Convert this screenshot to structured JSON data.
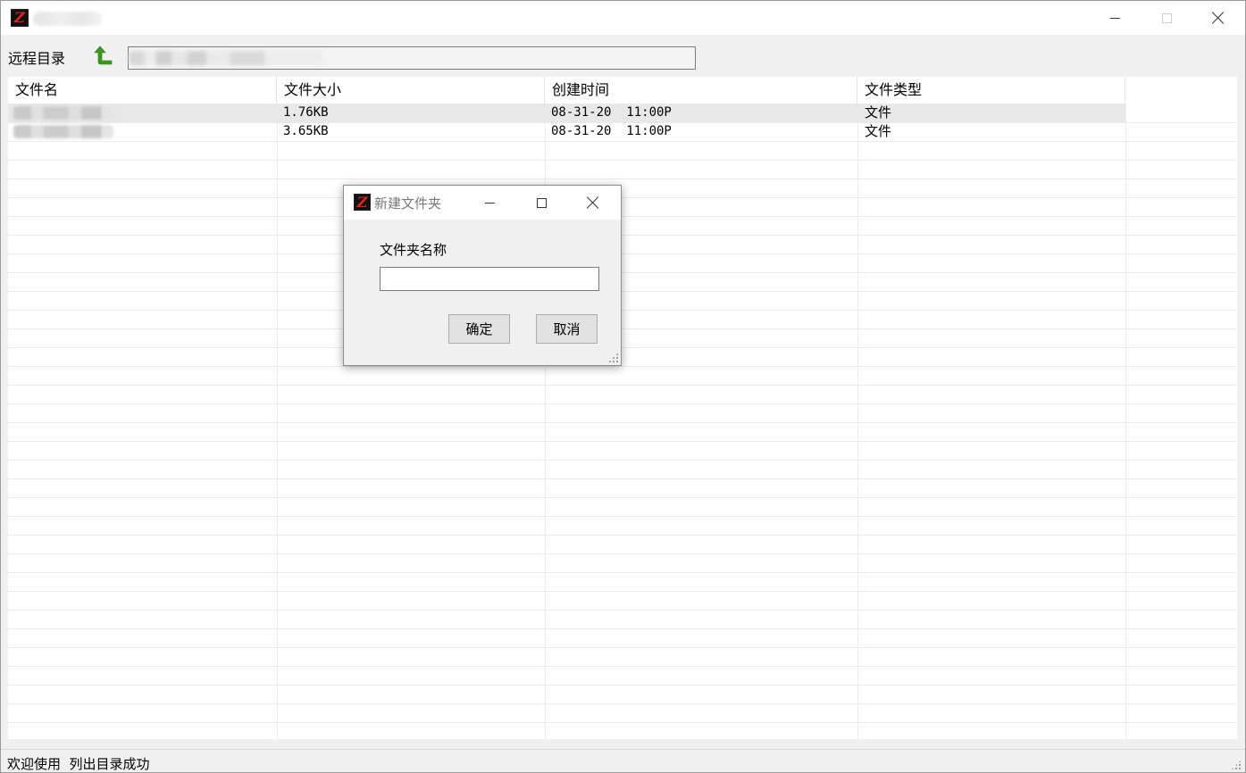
{
  "window": {
    "icon": "zoc-app-icon"
  },
  "toolbar": {
    "remote_dir_label": "远程目录",
    "up_icon": "green-up-arrow-icon",
    "path_value": ""
  },
  "file_list": {
    "columns": [
      "文件名",
      "文件大小",
      "创建时间",
      "文件类型"
    ],
    "rows": [
      {
        "name": "",
        "size": "1.76KB",
        "created": "08-31-20  11:00P",
        "type": "文件",
        "selected": true
      },
      {
        "name": "",
        "size": "3.65KB",
        "created": "08-31-20  11:00P",
        "type": "文件",
        "selected": false
      }
    ]
  },
  "status": {
    "text": "欢迎使用  列出目录成功"
  },
  "dialog": {
    "title": "新建文件夹",
    "field_label": "文件夹名称",
    "field_value": "",
    "ok_label": "确定",
    "cancel_label": "取消"
  }
}
